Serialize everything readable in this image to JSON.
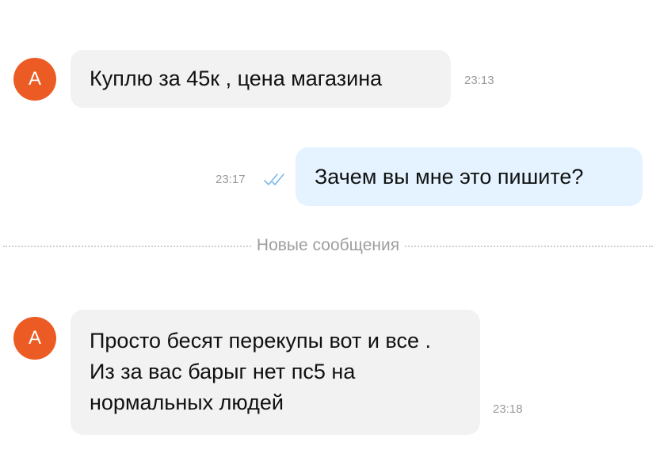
{
  "messages": [
    {
      "direction": "incoming",
      "avatar_letter": "А",
      "text": "Куплю за 45к , цена магазина",
      "time": "23:13"
    },
    {
      "direction": "outgoing",
      "text": "Зачем вы мне это пишите?",
      "time": "23:17",
      "status_icon": "double-check-icon"
    },
    {
      "direction": "incoming",
      "avatar_letter": "А",
      "text": "Просто бесят перекупы вот и все . Из за вас барыг нет пс5 на нормальных людей",
      "time": "23:18"
    }
  ],
  "divider": {
    "label": "Новые сообщения"
  },
  "colors": {
    "avatar": "#ec5b24",
    "incoming_bubble": "#f2f2f2",
    "outgoing_bubble": "#e4f3ff",
    "read_ticks": "#7ab8e8"
  }
}
